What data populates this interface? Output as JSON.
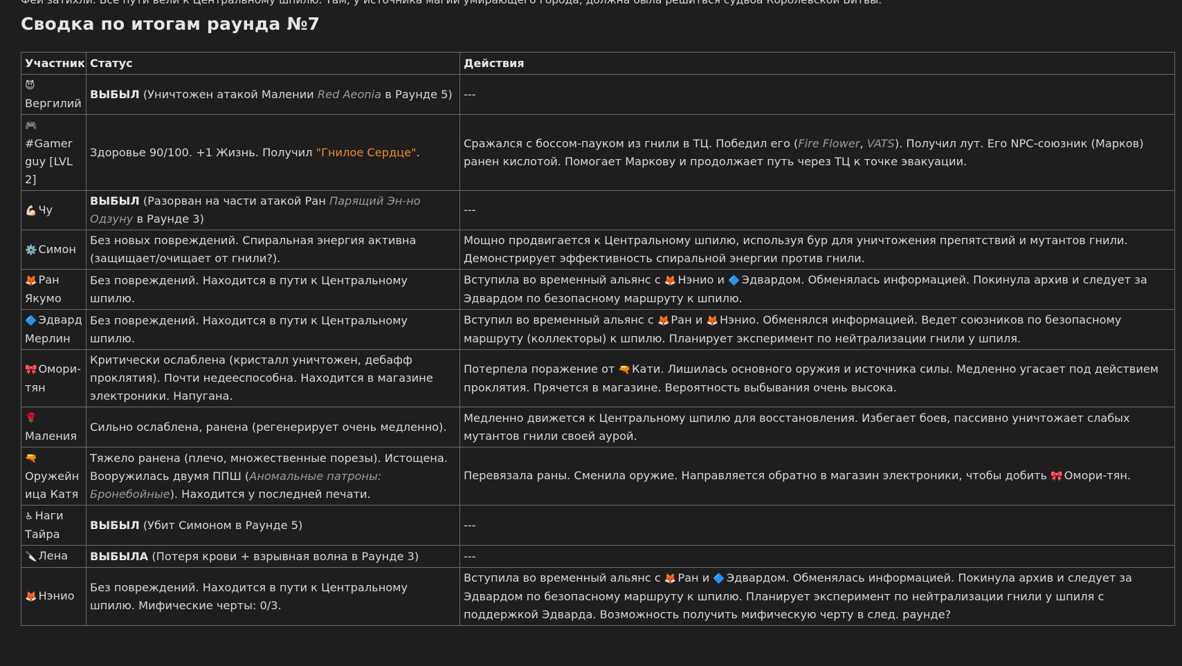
{
  "intro_text": "Феи затихли. Все пути вели к Центральному шпилю. Там, у источника магии умирающего города, должна была решиться судьба Королевской Битвы.",
  "heading": "Сводка по итогам раунда №7",
  "columns": {
    "participant": "Участник",
    "status": "Статус",
    "actions": "Действия"
  },
  "rows": [
    {
      "emoji": "😈",
      "name": "Вергилий",
      "status": [
        {
          "t": "ВЫБЫЛ",
          "s": "bold"
        },
        {
          "t": " (Уничтожен атакой Малении "
        },
        {
          "t": "Red Aeonia",
          "s": "italic"
        },
        {
          "t": " в Раунде 5)"
        }
      ],
      "actions": [
        {
          "t": "---"
        }
      ]
    },
    {
      "emoji": "🎮",
      "name": "#Gamer guy [LVL 2]",
      "status": [
        {
          "t": "Здоровье 90/100. +1 Жизнь. Получил "
        },
        {
          "t": "\"Гнилое Сердце\"",
          "s": "orange"
        },
        {
          "t": "."
        }
      ],
      "actions": [
        {
          "t": "Сражался с боссом-пауком из гнили в ТЦ. Победил его ("
        },
        {
          "t": "Fire Flower",
          "s": "italic"
        },
        {
          "t": ", "
        },
        {
          "t": "VATS",
          "s": "italic"
        },
        {
          "t": "). Получил лут. Его NPC-союзник (Марков) ранен кислотой. Помогает Маркову и продолжает путь через ТЦ к точке эвакуации."
        }
      ]
    },
    {
      "emoji": "💪🏻",
      "name": "Чу",
      "status": [
        {
          "t": "ВЫБЫЛ",
          "s": "bold"
        },
        {
          "t": " (Разорван на части атакой Ран "
        },
        {
          "t": "Парящий Эн-но Одзуну",
          "s": "italic"
        },
        {
          "t": " в Раунде 3)"
        }
      ],
      "actions": [
        {
          "t": "---"
        }
      ]
    },
    {
      "emoji": "⚙️",
      "name": "Симон",
      "status": [
        {
          "t": "Без новых повреждений. Спиральная энергия активна (защищает/очищает от гнили?)."
        }
      ],
      "actions": [
        {
          "t": "Мощно продвигается к Центральному шпилю, используя бур для уничтожения препятствий и мутантов гнили. Демонстрирует эффективность спиральной энергии против гнили."
        }
      ]
    },
    {
      "emoji": "🦊",
      "name": "Ран Якумо",
      "status": [
        {
          "t": "Без повреждений. Находится в пути к Центральному шпилю."
        }
      ],
      "actions": [
        {
          "t": "Вступила во временный альянс с "
        },
        {
          "t": "🦊",
          "s": "emoji"
        },
        {
          "t": "Нэнио и "
        },
        {
          "t": "🔷",
          "s": "emoji"
        },
        {
          "t": "Эдвардом. Обменялась информацией. Покинула архив и следует за Эдвардом по безопасному маршруту к шпилю."
        }
      ]
    },
    {
      "emoji": "🔷",
      "name": "Эдвард Мерлин",
      "status": [
        {
          "t": "Без повреждений. Находится в пути к Центральному шпилю."
        }
      ],
      "actions": [
        {
          "t": "Вступил во временный альянс с "
        },
        {
          "t": "🦊",
          "s": "emoji"
        },
        {
          "t": "Ран и "
        },
        {
          "t": "🦊",
          "s": "emoji"
        },
        {
          "t": "Нэнио. Обменялся информацией. Ведет союзников по безопасному маршруту (коллекторы) к шпилю. Планирует эксперимент по нейтрализации гнили у шпиля."
        }
      ]
    },
    {
      "emoji": "🎀",
      "name": "Омори-тян",
      "status": [
        {
          "t": "Критически ослаблена (кристалл уничтожен, дебафф проклятия). Почти недееспособна. Находится в магазине электроники. Напугана."
        }
      ],
      "actions": [
        {
          "t": "Потерпела поражение от "
        },
        {
          "t": "🔫",
          "s": "emoji"
        },
        {
          "t": "Кати. Лишилась основного оружия и источника силы. Медленно угасает под действием проклятия. Прячется в магазине. Вероятность выбывания очень высока."
        }
      ]
    },
    {
      "emoji": "🌹",
      "name": "Маления",
      "status": [
        {
          "t": "Сильно ослаблена, ранена (регенерирует очень медленно)."
        }
      ],
      "actions": [
        {
          "t": "Медленно движется к Центральному шпилю для восстановления. Избегает боев, пассивно уничтожает слабых мутантов гнили своей аурой."
        }
      ]
    },
    {
      "emoji": "🔫",
      "name": "Оружейн ица Катя",
      "status": [
        {
          "t": "Тяжело ранена (плечо, множественные порезы). Истощена. Вооружилась двумя ППШ ("
        },
        {
          "t": "Аномальные патроны: Бронебойные",
          "s": "italic"
        },
        {
          "t": "). Находится у последней печати."
        }
      ],
      "actions": [
        {
          "t": "Перевязала раны. Сменила оружие. Направляется обратно в магазин электроники, чтобы добить "
        },
        {
          "t": "🎀",
          "s": "emoji"
        },
        {
          "t": "Омори-тян."
        }
      ]
    },
    {
      "emoji": "♿",
      "name": "Наги Тайра",
      "status": [
        {
          "t": "ВЫБЫЛ",
          "s": "bold"
        },
        {
          "t": " (Убит Симоном в Раунде 5)"
        }
      ],
      "actions": [
        {
          "t": "---"
        }
      ]
    },
    {
      "emoji": "🔪",
      "name": "Лена",
      "status": [
        {
          "t": "ВЫБЫЛА",
          "s": "bold"
        },
        {
          "t": " (Потеря крови + взрывная волна в Раунде 3)"
        }
      ],
      "actions": [
        {
          "t": "---"
        }
      ]
    },
    {
      "emoji": "🦊",
      "name": "Нэнио",
      "status": [
        {
          "t": "Без повреждений. Находится в пути к Центральному шпилю. Мифические черты: 0/3."
        }
      ],
      "actions": [
        {
          "t": "Вступила во временный альянс с "
        },
        {
          "t": "🦊",
          "s": "emoji"
        },
        {
          "t": "Ран и "
        },
        {
          "t": "🔷",
          "s": "emoji"
        },
        {
          "t": "Эдвардом. Обменялась информацией. Покинула архив и следует за Эдвардом по безопасному маршруту к шпилю. Планирует эксперимент по нейтрализации гнили у шпиля с поддержкой Эдварда. Возможность получить мифическую черту в след. раунде?"
        }
      ]
    }
  ]
}
